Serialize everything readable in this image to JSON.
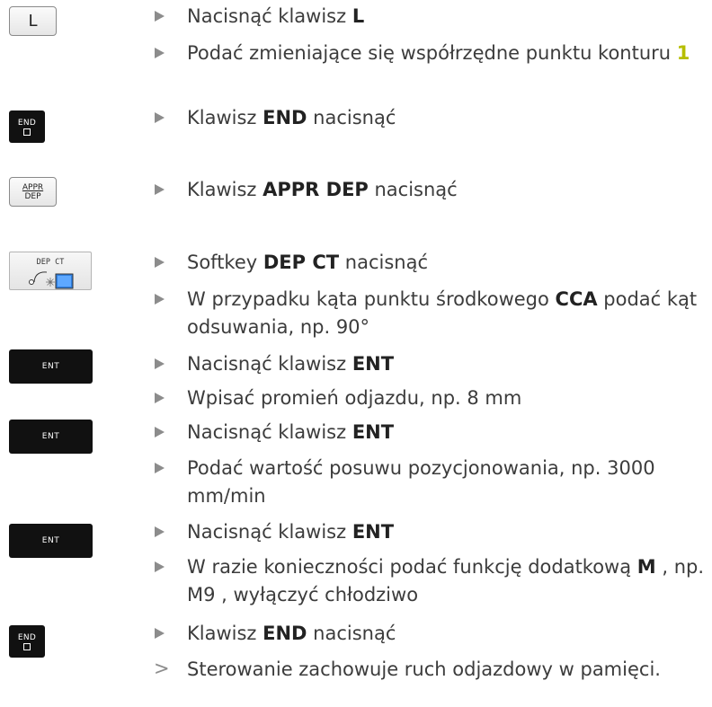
{
  "keys": {
    "l_key": "L",
    "end_label": "END",
    "appr_top": "APPR",
    "appr_bottom": "DEP",
    "dep_ct_label": "DEP  CT",
    "ent_label": "ENT"
  },
  "steps": [
    {
      "pre": "Nacisnąć klawisz ",
      "bold": "L",
      "post": ""
    },
    {
      "pre": "Podać zmieniające się współrzędne punktu konturu ",
      "bold": "1",
      "post": ""
    },
    {
      "pre": "Klawisz ",
      "bold": "END",
      "post": " nacisnąć"
    },
    {
      "pre": "Klawisz ",
      "bold": "APPR DEP",
      "post": " nacisnąć"
    },
    {
      "pre": "Softkey ",
      "bold": "DEP CT",
      "post": " nacisnąć"
    },
    {
      "pre": "W przypadku kąta punktu środkowego ",
      "bold": "CCA",
      "post": " podać kąt odsuwania, np. 90°"
    },
    {
      "pre": "Nacisnąć klawisz ",
      "bold": "ENT",
      "post": ""
    },
    {
      "pre": "Wpisać promień odjazdu, np. 8 mm",
      "bold": "",
      "post": ""
    },
    {
      "pre": "Nacisnąć klawisz ",
      "bold": "ENT",
      "post": ""
    },
    {
      "pre": "Podać wartość posuwu pozycjonowania, np. 3000 mm/min",
      "bold": "",
      "post": ""
    },
    {
      "pre": "Nacisnąć klawisz ",
      "bold": "ENT",
      "post": ""
    },
    {
      "pre": "W razie konieczności podać funkcję dodatkową ",
      "bold": "M",
      "post": " , np. M9 , wyłączyć chłodziwo"
    },
    {
      "pre": "Klawisz ",
      "bold": "END",
      "post": " nacisnąć"
    },
    {
      "pre": "Sterowanie zachowuje ruch odjazdowy w pamięci.",
      "bold": "",
      "post": ""
    }
  ],
  "colors": {
    "text": "#3c3c3c",
    "bullet": "#8c8c8c",
    "highlight": "#b6be00",
    "key_black": "#111111"
  }
}
